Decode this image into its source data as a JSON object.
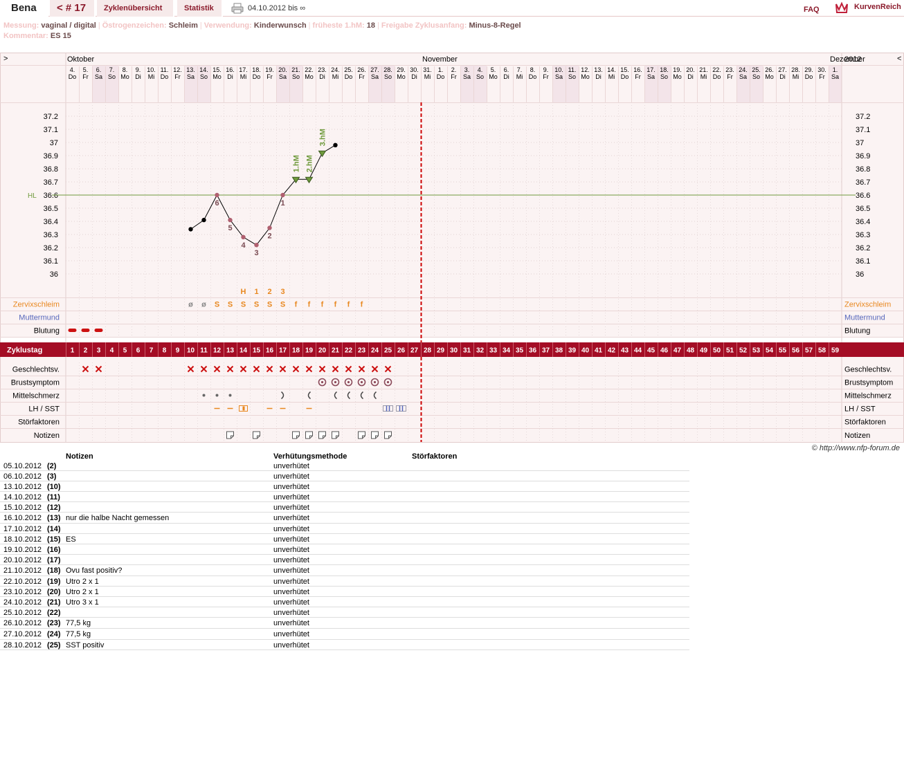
{
  "header": {
    "name": "Bena",
    "cycle": "< # 17",
    "overview": "Zyklenübersicht",
    "stats": "Statistik",
    "range": "04.10.2012 bis ∞",
    "faq": "FAQ",
    "logo": "KurvenReich"
  },
  "meta": {
    "line1": [
      {
        "label": "Messung:",
        "value": "vaginal / digital"
      },
      {
        "label": "Östrogenzeichen:",
        "value": "Schleim"
      },
      {
        "label": "Verwendung:",
        "value": "Kinderwunsch"
      },
      {
        "label": "früheste 1.hM:",
        "value": "18"
      },
      {
        "label": "Freigabe Zyklusanfang:",
        "value": "Minus-8-Regel"
      }
    ],
    "line2": [
      {
        "label": "Kommentar:",
        "value": "ES 15"
      }
    ]
  },
  "chart_data": {
    "type": "line",
    "nav_prev": ">",
    "nav_next": "<",
    "months": [
      {
        "label": "Oktober",
        "at": 1
      },
      {
        "label": "November",
        "at": 28
      },
      {
        "label": "Dezember",
        "at": 59
      }
    ],
    "year": "2012",
    "dates": [
      "4.",
      "5.",
      "6.",
      "7.",
      "8.",
      "9.",
      "10.",
      "11.",
      "12.",
      "13.",
      "14.",
      "15.",
      "16.",
      "17.",
      "18.",
      "19.",
      "20.",
      "21.",
      "22.",
      "23.",
      "24.",
      "25.",
      "26.",
      "27.",
      "28.",
      "29.",
      "30.",
      "31.",
      "1.",
      "2.",
      "3.",
      "4.",
      "5.",
      "6.",
      "7.",
      "8.",
      "9.",
      "10.",
      "11.",
      "12.",
      "13.",
      "14.",
      "15.",
      "16.",
      "17.",
      "18.",
      "19.",
      "20.",
      "21.",
      "22.",
      "23.",
      "24.",
      "25.",
      "26.",
      "27.",
      "28.",
      "29.",
      "30.",
      "1."
    ],
    "weekdays": [
      "Do",
      "Fr",
      "Sa",
      "So",
      "Mo",
      "Di",
      "Mi",
      "Do",
      "Fr",
      "Sa",
      "So",
      "Mo",
      "Di",
      "Mi",
      "Do",
      "Fr",
      "Sa",
      "So",
      "Mo",
      "Di",
      "Mi",
      "Do",
      "Fr",
      "Sa",
      "So",
      "Mo",
      "Di",
      "Mi",
      "Do",
      "Fr",
      "Sa",
      "So",
      "Mo",
      "Di",
      "Mi",
      "Do",
      "Fr",
      "Sa",
      "So",
      "Mo",
      "Di",
      "Mi",
      "Do",
      "Fr",
      "Sa",
      "So",
      "Mo",
      "Di",
      "Mi",
      "Do",
      "Fr",
      "Sa",
      "So",
      "Mo",
      "Di",
      "Mi",
      "Do",
      "Fr",
      "Sa"
    ],
    "yticks": [
      "37.2",
      "37.1",
      "37",
      "36.9",
      "36.8",
      "36.7",
      "36.6",
      "36.5",
      "36.4",
      "36.3",
      "36.2",
      "36.1",
      "36"
    ],
    "ylim": [
      36,
      37.2
    ],
    "hl_label": "HL",
    "hl_value": 36.6,
    "today_day": 27,
    "temps": [
      {
        "day": 10,
        "t": 36.34
      },
      {
        "day": 11,
        "t": 36.41
      },
      {
        "day": 12,
        "t": 36.6
      },
      {
        "day": 13,
        "t": 36.41
      },
      {
        "day": 14,
        "t": 36.28
      },
      {
        "day": 15,
        "t": 36.22
      },
      {
        "day": 16,
        "t": 36.35
      },
      {
        "day": 17,
        "t": 36.6
      },
      {
        "day": 18,
        "t": 36.72
      },
      {
        "day": 19,
        "t": 36.72
      },
      {
        "day": 20,
        "t": 36.92
      },
      {
        "day": 21,
        "t": 36.98
      }
    ],
    "point_labels": [
      {
        "day": 12,
        "text": "6"
      },
      {
        "day": 13,
        "text": "5"
      },
      {
        "day": 14,
        "text": "4"
      },
      {
        "day": 15,
        "text": "3"
      },
      {
        "day": 16,
        "text": "2"
      },
      {
        "day": 17,
        "text": "1"
      }
    ],
    "hm_labels": [
      {
        "day": 18,
        "text": "1.hM"
      },
      {
        "day": 19,
        "text": "2.hM"
      },
      {
        "day": 20,
        "text": "3.hM"
      }
    ],
    "peak_labels": [
      {
        "day": 14,
        "text": "H"
      },
      {
        "day": 15,
        "text": "1"
      },
      {
        "day": 16,
        "text": "2"
      },
      {
        "day": 17,
        "text": "3"
      }
    ],
    "rows": {
      "cervix": "Zervixschleim",
      "cervix_pos": "Muttermund",
      "bleeding": "Blutung",
      "cycleday": "Zyklustag",
      "sex": "Geschlechtsv.",
      "breast": "Brustsymptom",
      "midpain": "Mittelschmerz",
      "lh": "LH / SST",
      "disturb": "Störfaktoren",
      "notes": "Notizen"
    },
    "cervix": [
      {
        "day": 10,
        "v": "ø"
      },
      {
        "day": 11,
        "v": "ø"
      },
      {
        "day": 12,
        "v": "S"
      },
      {
        "day": 13,
        "v": "S"
      },
      {
        "day": 14,
        "v": "S"
      },
      {
        "day": 15,
        "v": "S"
      },
      {
        "day": 16,
        "v": "S"
      },
      {
        "day": 17,
        "v": "S"
      },
      {
        "day": 18,
        "v": "f"
      },
      {
        "day": 19,
        "v": "f"
      },
      {
        "day": 20,
        "v": "f"
      },
      {
        "day": 21,
        "v": "f"
      },
      {
        "day": 22,
        "v": "f"
      },
      {
        "day": 23,
        "v": "f"
      }
    ],
    "bleeding_days": [
      1,
      2,
      3
    ],
    "cycle_days": [
      "1",
      "2",
      "3",
      "4",
      "5",
      "6",
      "7",
      "8",
      "9",
      "10",
      "11",
      "12",
      "13",
      "14",
      "15",
      "16",
      "17",
      "18",
      "19",
      "20",
      "21",
      "22",
      "23",
      "24",
      "25",
      "26",
      "27",
      "28",
      "29",
      "30",
      "31",
      "32",
      "33",
      "34",
      "35",
      "36",
      "37",
      "38",
      "39",
      "40",
      "41",
      "42",
      "43",
      "44",
      "45",
      "46",
      "47",
      "48",
      "49",
      "50",
      "51",
      "52",
      "53",
      "54",
      "55",
      "56",
      "57",
      "58",
      "59"
    ],
    "sex_days": [
      2,
      3,
      10,
      11,
      12,
      13,
      14,
      15,
      16,
      17,
      18,
      19,
      20,
      21,
      22,
      23,
      24,
      25
    ],
    "breast_days": [
      20,
      21,
      22,
      23,
      24,
      25
    ],
    "midpain": [
      {
        "day": 11,
        "v": "dot"
      },
      {
        "day": 12,
        "v": "dot"
      },
      {
        "day": 13,
        "v": "dot"
      },
      {
        "day": 17,
        "v": "r"
      },
      {
        "day": 19,
        "v": "l"
      },
      {
        "day": 21,
        "v": "l"
      },
      {
        "day": 22,
        "v": "l"
      },
      {
        "day": 23,
        "v": "l"
      },
      {
        "day": 24,
        "v": "l"
      }
    ],
    "lh": [
      {
        "day": 12,
        "v": "lh"
      },
      {
        "day": 13,
        "v": "lh"
      },
      {
        "day": 14,
        "v": "lhp"
      },
      {
        "day": 16,
        "v": "lh"
      },
      {
        "day": 17,
        "v": "lh"
      },
      {
        "day": 19,
        "v": "lh"
      },
      {
        "day": 25,
        "v": "sst"
      },
      {
        "day": 26,
        "v": "sst"
      }
    ],
    "note_days": [
      13,
      15,
      18,
      19,
      20,
      21,
      23,
      24,
      25
    ]
  },
  "notes_table": {
    "headers": {
      "note": "Notizen",
      "method": "Verhütungsmethode",
      "stoer": "Störfaktoren"
    },
    "rows": [
      {
        "date": "05.10.2012",
        "day": "(2)",
        "note": "",
        "method": "unverhütet"
      },
      {
        "date": "06.10.2012",
        "day": "(3)",
        "note": "",
        "method": "unverhütet"
      },
      {
        "date": "13.10.2012",
        "day": "(10)",
        "note": "",
        "method": "unverhütet"
      },
      {
        "date": "14.10.2012",
        "day": "(11)",
        "note": "",
        "method": "unverhütet"
      },
      {
        "date": "15.10.2012",
        "day": "(12)",
        "note": "",
        "method": "unverhütet"
      },
      {
        "date": "16.10.2012",
        "day": "(13)",
        "note": "nur die halbe Nacht gemessen",
        "method": "unverhütet",
        "tall": true
      },
      {
        "date": "17.10.2012",
        "day": "(14)",
        "note": "",
        "method": "unverhütet"
      },
      {
        "date": "18.10.2012",
        "day": "(15)",
        "note": "ES",
        "method": "unverhütet"
      },
      {
        "date": "19.10.2012",
        "day": "(16)",
        "note": "",
        "method": "unverhütet"
      },
      {
        "date": "20.10.2012",
        "day": "(17)",
        "note": "",
        "method": "unverhütet"
      },
      {
        "date": "21.10.2012",
        "day": "(18)",
        "note": "Ovu fast positiv?",
        "method": "unverhütet",
        "tall": true
      },
      {
        "date": "22.10.2012",
        "day": "(19)",
        "note": "Utro 2 x 1",
        "method": "unverhütet"
      },
      {
        "date": "23.10.2012",
        "day": "(20)",
        "note": "Utro 2 x 1",
        "method": "unverhütet"
      },
      {
        "date": "24.10.2012",
        "day": "(21)",
        "note": "Utro 3 x 1",
        "method": "unverhütet"
      },
      {
        "date": "25.10.2012",
        "day": "(22)",
        "note": "",
        "method": "unverhütet"
      },
      {
        "date": "26.10.2012",
        "day": "(23)",
        "note": "77,5 kg",
        "method": "unverhütet",
        "tall": true
      },
      {
        "date": "27.10.2012",
        "day": "(24)",
        "note": "77,5 kg",
        "method": "unverhütet",
        "tall": true
      },
      {
        "date": "28.10.2012",
        "day": "(25)",
        "note": "SST positiv",
        "method": "unverhütet"
      }
    ]
  },
  "credit": "© http://www.nfp-forum.de",
  "colors": {
    "accent": "#8b1a2b",
    "weekend": "#f3e4e9",
    "cervix": "#e8871e",
    "pos": "#5566bb",
    "hl": "#6f9a3c",
    "dashed": "#cc0000",
    "pink": "#b06070"
  }
}
